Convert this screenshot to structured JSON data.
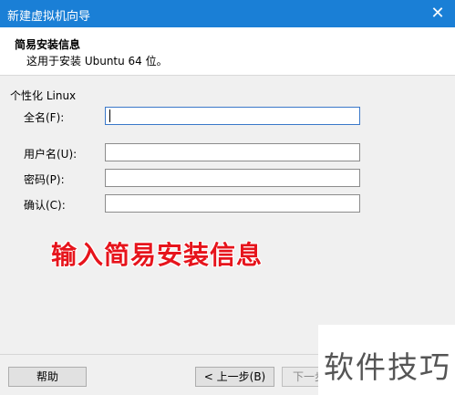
{
  "window": {
    "title": "新建虚拟机向导",
    "close_glyph": "✕"
  },
  "header": {
    "title": "简易安装信息",
    "subtitle": "这用于安装 Ubuntu 64 位。"
  },
  "group": {
    "label": "个性化 Linux"
  },
  "fields": {
    "fullname": {
      "label": "全名(F):",
      "value": ""
    },
    "username": {
      "label": "用户名(U):",
      "value": ""
    },
    "password": {
      "label": "密码(P):",
      "value": ""
    },
    "confirm": {
      "label": "确认(C):",
      "value": ""
    }
  },
  "annotation": {
    "text": "输入简易安装信息",
    "color": "#e6141c"
  },
  "buttons": {
    "help": "帮助",
    "back": "< 上一步(B)",
    "next": "下一步"
  },
  "watermark": {
    "text": "软件技巧"
  },
  "colors": {
    "titlebar": "#1a7fd6"
  }
}
